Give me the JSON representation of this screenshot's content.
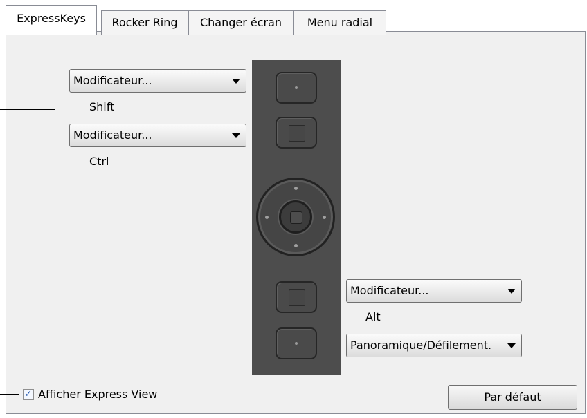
{
  "tabs": [
    {
      "label": "ExpressKeys",
      "active": true
    },
    {
      "label": "Rocker Ring",
      "active": false
    },
    {
      "label": "Changer écran",
      "active": false
    },
    {
      "label": "Menu radial",
      "active": false
    }
  ],
  "keys": {
    "left_top": {
      "function": "Modificateur...",
      "detail": "Shift"
    },
    "left_second": {
      "function": "Modificateur...",
      "detail": "Ctrl"
    },
    "right_lower": {
      "function": "Modificateur...",
      "detail": "Alt"
    },
    "right_bottom": {
      "function": "Panoramique/Défilement."
    }
  },
  "show_express_view": {
    "checked": true,
    "label": "Afficher Express View",
    "check_glyph": "✓"
  },
  "default_button": {
    "label": "Par défaut"
  },
  "icons": {
    "dropdown": "chevron-down-icon",
    "checkbox": "checkmark-icon"
  },
  "colors": {
    "device_body": "#4d4d4d",
    "panel_bg": "#f0f0f0",
    "border": "#898c95"
  }
}
